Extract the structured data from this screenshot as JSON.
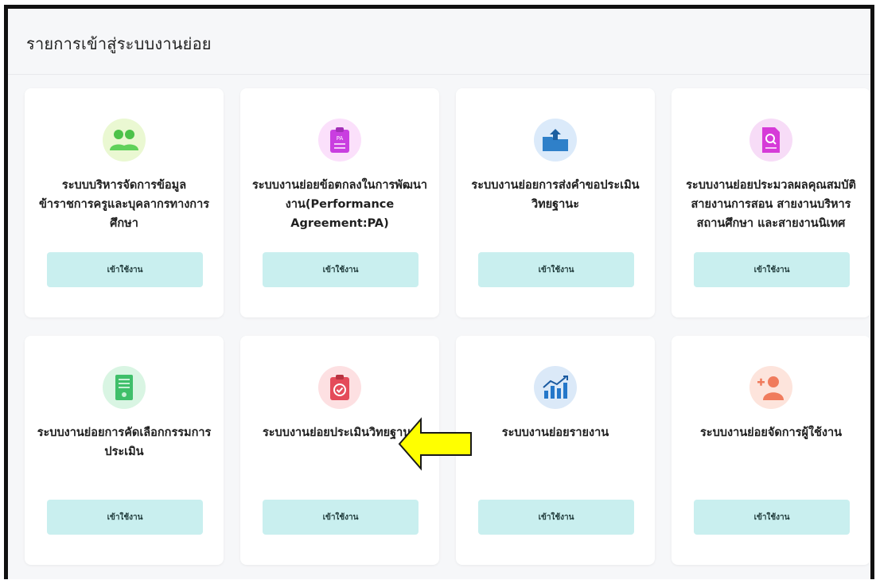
{
  "page": {
    "title": "รายการเข้าสู่ระบบงานย่อย"
  },
  "cards": [
    {
      "title": "ระบบบริหารจัดการข้อมูลข้าราชการครูและบุคลากรทางการศึกษา",
      "button": "เข้าใช้งาน",
      "icon": "users-icon",
      "accent": "#5fd15a"
    },
    {
      "title": "ระบบงานย่อยข้อตกลงในการพัฒนางาน(Performance Agreement:PA)",
      "button": "เข้าใช้งาน",
      "icon": "clipboard-pa-icon",
      "accent": "#c93ee0",
      "icon_text": "PA"
    },
    {
      "title": "ระบบงานย่อยการส่งคำขอประเมินวิทยฐานะ",
      "button": "เข้าใช้งาน",
      "icon": "upload-folder-icon",
      "accent": "#2f80c9"
    },
    {
      "title": "ระบบงานย่อยประมวลผลคุณสมบัติสายงานการสอน สายงานบริหารสถานศึกษา และสายงานนิเทศ",
      "button": "เข้าใช้งาน",
      "icon": "document-search-icon",
      "accent": "#d63ad8"
    },
    {
      "title": "ระบบงานย่อยการคัดเลือกกรรมการประเมิน",
      "button": "เข้าใช้งาน",
      "icon": "certificate-icon",
      "accent": "#3fbf6a"
    },
    {
      "title": "ระบบงานย่อยประเมินวิทยฐานะ",
      "button": "เข้าใช้งาน",
      "icon": "clipboard-check-icon",
      "accent": "#e44b5a"
    },
    {
      "title": "ระบบงานย่อยรายงาน",
      "button": "เข้าใช้งาน",
      "icon": "bar-chart-icon",
      "accent": "#2477c9"
    },
    {
      "title": "ระบบงานย่อยจัดการผู้ใช้งาน",
      "button": "เข้าใช้งาน",
      "icon": "add-user-icon",
      "accent": "#f07b5c"
    }
  ],
  "annotation": {
    "icon": "arrow-left-icon",
    "color": "#ffff00"
  }
}
